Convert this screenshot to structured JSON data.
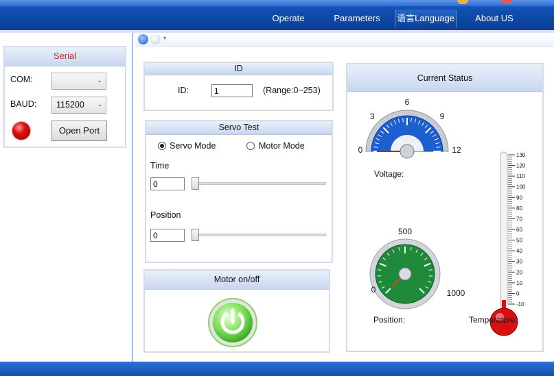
{
  "menu": {
    "items": [
      {
        "label": "Operate"
      },
      {
        "label": "Parameters"
      },
      {
        "label": "语言Language"
      },
      {
        "label": "About US"
      }
    ]
  },
  "serial": {
    "title": "Serial",
    "com_label": "COM:",
    "com_value": "",
    "baud_label": "BAUD:",
    "baud_value": "115200",
    "open_button": "Open Port",
    "led_color": "#e01010"
  },
  "id_panel": {
    "title": "ID",
    "id_label": "ID:",
    "id_value": "1",
    "range_text": "(Range:0~253)"
  },
  "servo_test": {
    "title": "Servo Test",
    "mode_servo": "Servo Mode",
    "mode_motor": "Motor Mode",
    "selected_mode": "Servo Mode",
    "time_label": "Time",
    "time_value": "0",
    "time_slider_fraction": 0,
    "position_label": "Position",
    "position_value": "0",
    "position_slider_fraction": 0
  },
  "motor": {
    "title": "Motor on/off",
    "power_icon": "power-icon",
    "state_color": "#5fd13a"
  },
  "status": {
    "title": "Current Status",
    "voltage": {
      "label": "Voltage:",
      "ticks": [
        "0",
        "3",
        "6",
        "9",
        "12"
      ],
      "value": 0,
      "max": 12
    },
    "position": {
      "label": "Position:",
      "ticks": [
        "0",
        "500",
        "1000"
      ],
      "value": 0,
      "max": 1000
    },
    "temperature": {
      "label": "Temperature:",
      "ticks": [
        "130",
        "120",
        "110",
        "100",
        "90",
        "80",
        "70",
        "60",
        "50",
        "40",
        "30",
        "20",
        "10",
        "0",
        "-10"
      ],
      "value": -10
    }
  },
  "colors": {
    "accent": "#0f4fb0",
    "voltage_gauge": "#1d5fd0",
    "position_gauge": "#1f8a3a",
    "thermometer": "#d81010"
  }
}
